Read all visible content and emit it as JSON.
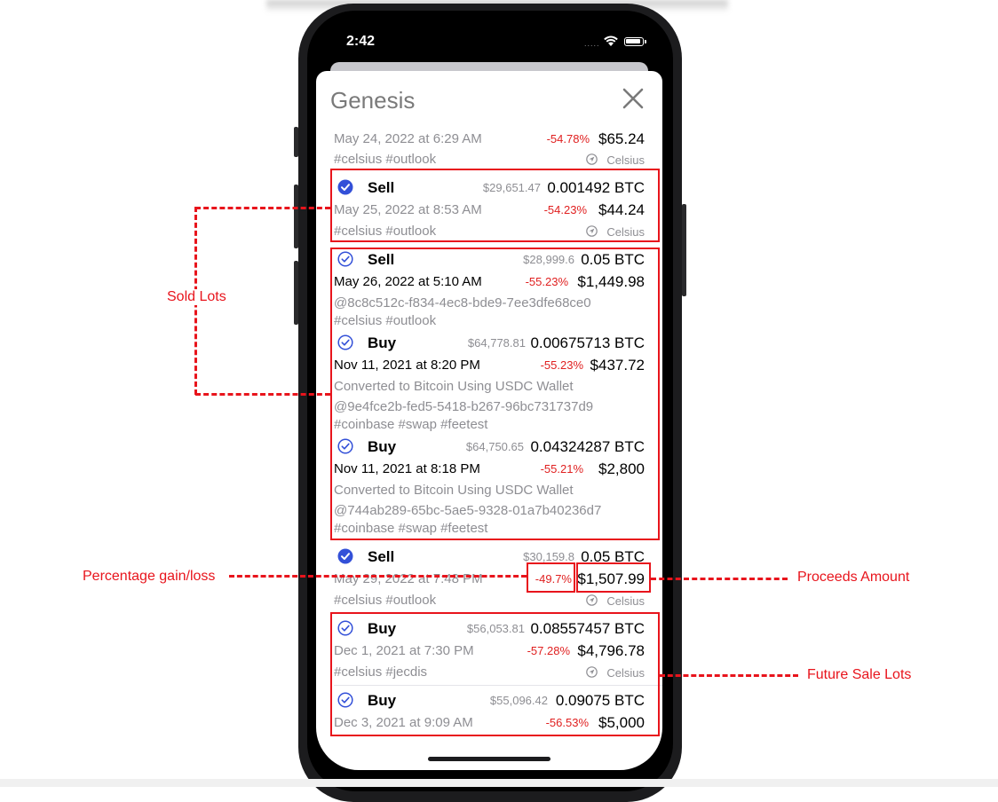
{
  "status_bar": {
    "time": "2:42",
    "signal": "....."
  },
  "sheet": {
    "title": "Genesis"
  },
  "transactions": [
    {
      "label": "",
      "rate": "",
      "quantity": "",
      "date": "May 24, 2022 at 6:29 AM",
      "percent": "-54.78%",
      "amount": "$65.24",
      "tags": "#celsius #outlook",
      "wallet": "Celsius"
    },
    {
      "label": "Sell",
      "rate": "$29,651.47",
      "quantity": "0.001492 BTC",
      "date": "May 25, 2022 at 8:53 AM",
      "percent": "-54.23%",
      "amount": "$44.24",
      "tags": "#celsius #outlook",
      "wallet": "Celsius"
    },
    {
      "label": "Sell",
      "rate": "$28,999.6",
      "quantity": "0.05 BTC",
      "date": "May 26, 2022 at 5:10 AM",
      "percent": "-55.23%",
      "amount": "$1,449.98",
      "id": "@8c8c512c-f834-4ec8-bde9-7ee3dfe68ce0",
      "tags": "#celsius #outlook"
    },
    {
      "label": "Buy",
      "rate": "$64,778.81",
      "quantity": "0.00675713 BTC",
      "date": "Nov 11, 2021 at 8:20 PM",
      "percent": "-55.23%",
      "amount": "$437.72",
      "note": "Converted to Bitcoin Using USDC Wallet",
      "id": "@9e4fce2b-fed5-5418-b267-96bc731737d9",
      "tags": "#coinbase #swap #feetest"
    },
    {
      "label": "Buy",
      "rate": "$64,750.65",
      "quantity": "0.04324287 BTC",
      "date": "Nov 11, 2021 at 8:18 PM",
      "percent": "-55.21%",
      "amount": "$2,800",
      "note": "Converted to Bitcoin Using USDC Wallet",
      "id": "@744ab289-65bc-5ae5-9328-01a7b40236d7",
      "tags": "#coinbase #swap #feetest"
    },
    {
      "label": "Sell",
      "rate": "$30,159.8",
      "quantity": "0.05 BTC",
      "date": "May 29, 2022 at 7:48 PM",
      "percent": "-49.7%",
      "amount": "$1,507.99",
      "tags": "#celsius #outlook",
      "wallet": "Celsius"
    },
    {
      "label": "Buy",
      "rate": "$56,053.81",
      "quantity": "0.08557457 BTC",
      "date": "Dec 1, 2021 at 7:30 PM",
      "percent": "-57.28%",
      "amount": "$4,796.78",
      "tags": "#celsius #jecdis",
      "wallet": "Celsius"
    },
    {
      "label": "Buy",
      "rate": "$55,096.42",
      "quantity": "0.09075 BTC",
      "date": "Dec 3, 2021 at 9:09 AM",
      "percent": "-56.53%",
      "amount": "$5,000"
    }
  ],
  "annotations": {
    "sold_lots": "Sold Lots",
    "percentage": "Percentage gain/loss",
    "proceeds": "Proceeds Amount",
    "future_sale": "Future Sale Lots"
  },
  "colors": {
    "accent_blue": "#3350d8",
    "loss_red": "#e02020",
    "annotation_red": "#e8141c"
  },
  "icons": {
    "check_filled": "checkmark-circle-filled-icon",
    "check_outline": "checkmark-circle-outline-icon",
    "wallet": "location-arrow-icon",
    "close": "close-x-icon"
  }
}
